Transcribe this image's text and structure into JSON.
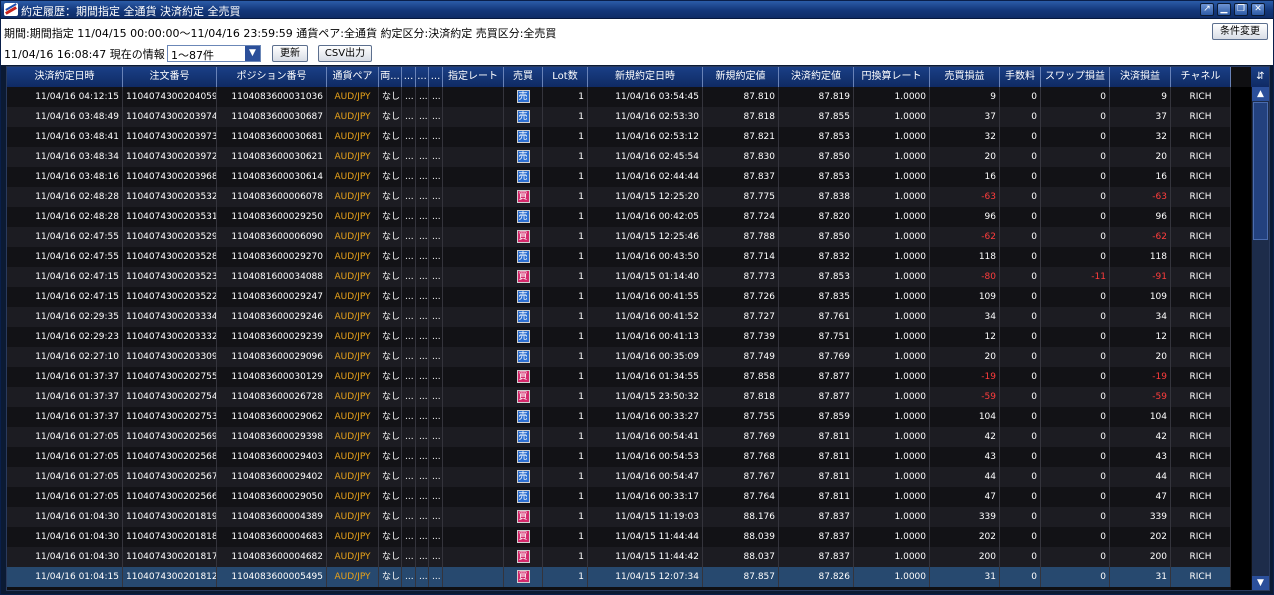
{
  "window": {
    "title": "約定履歴：期間指定 全通貨 決済約定 全売買",
    "controls": [
      "restore-icon",
      "minimize-icon",
      "maximize-icon",
      "close-icon"
    ]
  },
  "toolbar": {
    "condition_text": "期間:期間指定 11/04/15 00:00:00〜11/04/16 23:59:59 通貨ペア:全通貨 約定区分:決済約定 売買区分:全売買",
    "info_text": "11/04/16 16:08:47 現在の情報",
    "page_select": "1〜87件",
    "update_label": "更新",
    "csv_label": "CSV出力",
    "change_label": "条件変更"
  },
  "columns": [
    "決済約定日時",
    "注文番号",
    "ポジション番号",
    "通貨ペア",
    "両...",
    "...",
    "...",
    "...",
    "指定レート",
    "売買",
    "Lot数",
    "新規約定日時",
    "新規約定値",
    "決済約定値",
    "円換算レート",
    "売買損益",
    "手数料",
    "スワップ損益",
    "決済損益",
    "チャネル"
  ],
  "rows": [
    {
      "date": "11/04/16 04:12:15",
      "order": "1104074300204059",
      "pos": "1104083600031036",
      "pair": "AUD/JPY",
      "both": "なし",
      "d1": "...",
      "d2": "...",
      "d3": "...",
      "rate": "",
      "side": "売",
      "lot": "1",
      "open": "11/04/16 03:54:45",
      "open_price": "87.810",
      "close_price": "87.819",
      "yen": "1.0000",
      "pl": "9",
      "fee": "0",
      "swap": "0",
      "net": "9",
      "ch": "RICH"
    },
    {
      "date": "11/04/16 03:48:49",
      "order": "1104074300203974",
      "pos": "1104083600030687",
      "pair": "AUD/JPY",
      "both": "なし",
      "d1": "...",
      "d2": "...",
      "d3": "...",
      "rate": "",
      "side": "売",
      "lot": "1",
      "open": "11/04/16 02:53:30",
      "open_price": "87.818",
      "close_price": "87.855",
      "yen": "1.0000",
      "pl": "37",
      "fee": "0",
      "swap": "0",
      "net": "37",
      "ch": "RICH"
    },
    {
      "date": "11/04/16 03:48:41",
      "order": "1104074300203973",
      "pos": "1104083600030681",
      "pair": "AUD/JPY",
      "both": "なし",
      "d1": "...",
      "d2": "...",
      "d3": "...",
      "rate": "",
      "side": "売",
      "lot": "1",
      "open": "11/04/16 02:53:12",
      "open_price": "87.821",
      "close_price": "87.853",
      "yen": "1.0000",
      "pl": "32",
      "fee": "0",
      "swap": "0",
      "net": "32",
      "ch": "RICH"
    },
    {
      "date": "11/04/16 03:48:34",
      "order": "1104074300203972",
      "pos": "1104083600030621",
      "pair": "AUD/JPY",
      "both": "なし",
      "d1": "...",
      "d2": "...",
      "d3": "...",
      "rate": "",
      "side": "売",
      "lot": "1",
      "open": "11/04/16 02:45:54",
      "open_price": "87.830",
      "close_price": "87.850",
      "yen": "1.0000",
      "pl": "20",
      "fee": "0",
      "swap": "0",
      "net": "20",
      "ch": "RICH"
    },
    {
      "date": "11/04/16 03:48:16",
      "order": "1104074300203968",
      "pos": "1104083600030614",
      "pair": "AUD/JPY",
      "both": "なし",
      "d1": "...",
      "d2": "...",
      "d3": "...",
      "rate": "",
      "side": "売",
      "lot": "1",
      "open": "11/04/16 02:44:44",
      "open_price": "87.837",
      "close_price": "87.853",
      "yen": "1.0000",
      "pl": "16",
      "fee": "0",
      "swap": "0",
      "net": "16",
      "ch": "RICH"
    },
    {
      "date": "11/04/16 02:48:28",
      "order": "1104074300203532",
      "pos": "1104083600006078",
      "pair": "AUD/JPY",
      "both": "なし",
      "d1": "...",
      "d2": "...",
      "d3": "...",
      "rate": "",
      "side": "買",
      "lot": "1",
      "open": "11/04/15 12:25:20",
      "open_price": "87.775",
      "close_price": "87.838",
      "yen": "1.0000",
      "pl": "-63",
      "fee": "0",
      "swap": "0",
      "net": "-63",
      "ch": "RICH"
    },
    {
      "date": "11/04/16 02:48:28",
      "order": "1104074300203531",
      "pos": "1104083600029250",
      "pair": "AUD/JPY",
      "both": "なし",
      "d1": "...",
      "d2": "...",
      "d3": "...",
      "rate": "",
      "side": "売",
      "lot": "1",
      "open": "11/04/16 00:42:05",
      "open_price": "87.724",
      "close_price": "87.820",
      "yen": "1.0000",
      "pl": "96",
      "fee": "0",
      "swap": "0",
      "net": "96",
      "ch": "RICH"
    },
    {
      "date": "11/04/16 02:47:55",
      "order": "1104074300203529",
      "pos": "1104083600006090",
      "pair": "AUD/JPY",
      "both": "なし",
      "d1": "...",
      "d2": "...",
      "d3": "...",
      "rate": "",
      "side": "買",
      "lot": "1",
      "open": "11/04/15 12:25:46",
      "open_price": "87.788",
      "close_price": "87.850",
      "yen": "1.0000",
      "pl": "-62",
      "fee": "0",
      "swap": "0",
      "net": "-62",
      "ch": "RICH"
    },
    {
      "date": "11/04/16 02:47:55",
      "order": "1104074300203528",
      "pos": "1104083600029270",
      "pair": "AUD/JPY",
      "both": "なし",
      "d1": "...",
      "d2": "...",
      "d3": "...",
      "rate": "",
      "side": "売",
      "lot": "1",
      "open": "11/04/16 00:43:50",
      "open_price": "87.714",
      "close_price": "87.832",
      "yen": "1.0000",
      "pl": "118",
      "fee": "0",
      "swap": "0",
      "net": "118",
      "ch": "RICH"
    },
    {
      "date": "11/04/16 02:47:15",
      "order": "1104074300203523",
      "pos": "1104081600034088",
      "pair": "AUD/JPY",
      "both": "なし",
      "d1": "...",
      "d2": "...",
      "d3": "...",
      "rate": "",
      "side": "買",
      "lot": "1",
      "open": "11/04/15 01:14:40",
      "open_price": "87.773",
      "close_price": "87.853",
      "yen": "1.0000",
      "pl": "-80",
      "fee": "0",
      "swap": "-11",
      "net": "-91",
      "ch": "RICH"
    },
    {
      "date": "11/04/16 02:47:15",
      "order": "1104074300203522",
      "pos": "1104083600029247",
      "pair": "AUD/JPY",
      "both": "なし",
      "d1": "...",
      "d2": "...",
      "d3": "...",
      "rate": "",
      "side": "売",
      "lot": "1",
      "open": "11/04/16 00:41:55",
      "open_price": "87.726",
      "close_price": "87.835",
      "yen": "1.0000",
      "pl": "109",
      "fee": "0",
      "swap": "0",
      "net": "109",
      "ch": "RICH"
    },
    {
      "date": "11/04/16 02:29:35",
      "order": "1104074300203334",
      "pos": "1104083600029246",
      "pair": "AUD/JPY",
      "both": "なし",
      "d1": "...",
      "d2": "...",
      "d3": "...",
      "rate": "",
      "side": "売",
      "lot": "1",
      "open": "11/04/16 00:41:52",
      "open_price": "87.727",
      "close_price": "87.761",
      "yen": "1.0000",
      "pl": "34",
      "fee": "0",
      "swap": "0",
      "net": "34",
      "ch": "RICH"
    },
    {
      "date": "11/04/16 02:29:23",
      "order": "1104074300203332",
      "pos": "1104083600029239",
      "pair": "AUD/JPY",
      "both": "なし",
      "d1": "...",
      "d2": "...",
      "d3": "...",
      "rate": "",
      "side": "売",
      "lot": "1",
      "open": "11/04/16 00:41:13",
      "open_price": "87.739",
      "close_price": "87.751",
      "yen": "1.0000",
      "pl": "12",
      "fee": "0",
      "swap": "0",
      "net": "12",
      "ch": "RICH"
    },
    {
      "date": "11/04/16 02:27:10",
      "order": "1104074300203309",
      "pos": "1104083600029096",
      "pair": "AUD/JPY",
      "both": "なし",
      "d1": "...",
      "d2": "...",
      "d3": "...",
      "rate": "",
      "side": "売",
      "lot": "1",
      "open": "11/04/16 00:35:09",
      "open_price": "87.749",
      "close_price": "87.769",
      "yen": "1.0000",
      "pl": "20",
      "fee": "0",
      "swap": "0",
      "net": "20",
      "ch": "RICH"
    },
    {
      "date": "11/04/16 01:37:37",
      "order": "1104074300202755",
      "pos": "1104083600030129",
      "pair": "AUD/JPY",
      "both": "なし",
      "d1": "...",
      "d2": "...",
      "d3": "...",
      "rate": "",
      "side": "買",
      "lot": "1",
      "open": "11/04/16 01:34:55",
      "open_price": "87.858",
      "close_price": "87.877",
      "yen": "1.0000",
      "pl": "-19",
      "fee": "0",
      "swap": "0",
      "net": "-19",
      "ch": "RICH"
    },
    {
      "date": "11/04/16 01:37:37",
      "order": "1104074300202754",
      "pos": "1104083600026728",
      "pair": "AUD/JPY",
      "both": "なし",
      "d1": "...",
      "d2": "...",
      "d3": "...",
      "rate": "",
      "side": "買",
      "lot": "1",
      "open": "11/04/15 23:50:32",
      "open_price": "87.818",
      "close_price": "87.877",
      "yen": "1.0000",
      "pl": "-59",
      "fee": "0",
      "swap": "0",
      "net": "-59",
      "ch": "RICH"
    },
    {
      "date": "11/04/16 01:37:37",
      "order": "1104074300202753",
      "pos": "1104083600029062",
      "pair": "AUD/JPY",
      "both": "なし",
      "d1": "...",
      "d2": "...",
      "d3": "...",
      "rate": "",
      "side": "売",
      "lot": "1",
      "open": "11/04/16 00:33:27",
      "open_price": "87.755",
      "close_price": "87.859",
      "yen": "1.0000",
      "pl": "104",
      "fee": "0",
      "swap": "0",
      "net": "104",
      "ch": "RICH"
    },
    {
      "date": "11/04/16 01:27:05",
      "order": "1104074300202569",
      "pos": "1104083600029398",
      "pair": "AUD/JPY",
      "both": "なし",
      "d1": "...",
      "d2": "...",
      "d3": "...",
      "rate": "",
      "side": "売",
      "lot": "1",
      "open": "11/04/16 00:54:41",
      "open_price": "87.769",
      "close_price": "87.811",
      "yen": "1.0000",
      "pl": "42",
      "fee": "0",
      "swap": "0",
      "net": "42",
      "ch": "RICH"
    },
    {
      "date": "11/04/16 01:27:05",
      "order": "1104074300202568",
      "pos": "1104083600029403",
      "pair": "AUD/JPY",
      "both": "なし",
      "d1": "...",
      "d2": "...",
      "d3": "...",
      "rate": "",
      "side": "売",
      "lot": "1",
      "open": "11/04/16 00:54:53",
      "open_price": "87.768",
      "close_price": "87.811",
      "yen": "1.0000",
      "pl": "43",
      "fee": "0",
      "swap": "0",
      "net": "43",
      "ch": "RICH"
    },
    {
      "date": "11/04/16 01:27:05",
      "order": "1104074300202567",
      "pos": "1104083600029402",
      "pair": "AUD/JPY",
      "both": "なし",
      "d1": "...",
      "d2": "...",
      "d3": "...",
      "rate": "",
      "side": "売",
      "lot": "1",
      "open": "11/04/16 00:54:47",
      "open_price": "87.767",
      "close_price": "87.811",
      "yen": "1.0000",
      "pl": "44",
      "fee": "0",
      "swap": "0",
      "net": "44",
      "ch": "RICH"
    },
    {
      "date": "11/04/16 01:27:05",
      "order": "1104074300202566",
      "pos": "1104083600029050",
      "pair": "AUD/JPY",
      "both": "なし",
      "d1": "...",
      "d2": "...",
      "d3": "...",
      "rate": "",
      "side": "売",
      "lot": "1",
      "open": "11/04/16 00:33:17",
      "open_price": "87.764",
      "close_price": "87.811",
      "yen": "1.0000",
      "pl": "47",
      "fee": "0",
      "swap": "0",
      "net": "47",
      "ch": "RICH"
    },
    {
      "date": "11/04/16 01:04:30",
      "order": "1104074300201819",
      "pos": "1104083600004389",
      "pair": "AUD/JPY",
      "both": "なし",
      "d1": "...",
      "d2": "...",
      "d3": "...",
      "rate": "",
      "side": "買",
      "lot": "1",
      "open": "11/04/15 11:19:03",
      "open_price": "88.176",
      "close_price": "87.837",
      "yen": "1.0000",
      "pl": "339",
      "fee": "0",
      "swap": "0",
      "net": "339",
      "ch": "RICH"
    },
    {
      "date": "11/04/16 01:04:30",
      "order": "1104074300201818",
      "pos": "1104083600004683",
      "pair": "AUD/JPY",
      "both": "なし",
      "d1": "...",
      "d2": "...",
      "d3": "...",
      "rate": "",
      "side": "買",
      "lot": "1",
      "open": "11/04/15 11:44:44",
      "open_price": "88.039",
      "close_price": "87.837",
      "yen": "1.0000",
      "pl": "202",
      "fee": "0",
      "swap": "0",
      "net": "202",
      "ch": "RICH"
    },
    {
      "date": "11/04/16 01:04:30",
      "order": "1104074300201817",
      "pos": "1104083600004682",
      "pair": "AUD/JPY",
      "both": "なし",
      "d1": "...",
      "d2": "...",
      "d3": "...",
      "rate": "",
      "side": "買",
      "lot": "1",
      "open": "11/04/15 11:44:42",
      "open_price": "88.037",
      "close_price": "87.837",
      "yen": "1.0000",
      "pl": "200",
      "fee": "0",
      "swap": "0",
      "net": "200",
      "ch": "RICH"
    },
    {
      "date": "11/04/16 01:04:15",
      "order": "1104074300201812",
      "pos": "1104083600005495",
      "pair": "AUD/JPY",
      "both": "なし",
      "d1": "...",
      "d2": "...",
      "d3": "...",
      "rate": "",
      "side": "買",
      "lot": "1",
      "open": "11/04/15 12:07:34",
      "open_price": "87.857",
      "close_price": "87.826",
      "yen": "1.0000",
      "pl": "31",
      "fee": "0",
      "swap": "0",
      "net": "31",
      "ch": "RICH",
      "selected": true
    }
  ],
  "colors": {
    "header_bg": "#143577",
    "sell_badge": "#2e6fd1",
    "buy_badge": "#d3286b",
    "pair_text": "#e8a21a",
    "negative_text": "#ff3d3d",
    "selected_row": "#27496f"
  }
}
